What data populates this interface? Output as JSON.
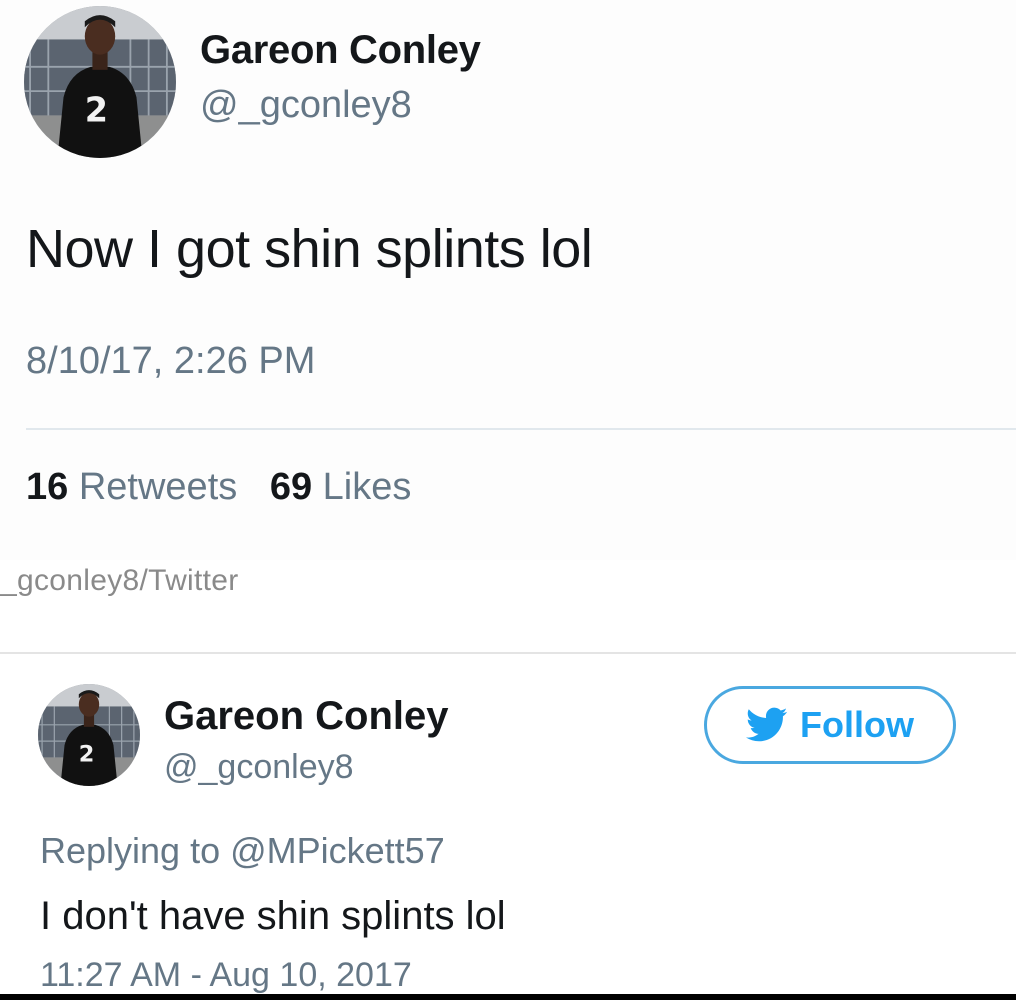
{
  "tweet": {
    "author_name": "Gareon Conley",
    "author_handle": "@_gconley8",
    "text": "Now I got shin splints lol",
    "timestamp": "8/10/17, 2:26 PM",
    "retweets_count": "16",
    "retweets_label": "Retweets",
    "likes_count": "69",
    "likes_label": "Likes",
    "avatar_icon": "profile-photo-icon",
    "jersey_number": "2"
  },
  "credit": "_gconley8/Twitter",
  "reply_tweet": {
    "author_name": "Gareon Conley",
    "author_handle": "@_gconley8",
    "follow_label": "Follow",
    "follow_icon": "twitter-bird-icon",
    "replying_to": "Replying to @MPickett57",
    "text": "I don't have shin splints lol",
    "timestamp": "11:27 AM - Aug 10, 2017",
    "avatar_icon": "profile-photo-icon",
    "jersey_number": "2"
  },
  "colors": {
    "twitter_blue": "#1da1f2",
    "secondary_text": "#657786",
    "primary_text": "#14171a"
  }
}
